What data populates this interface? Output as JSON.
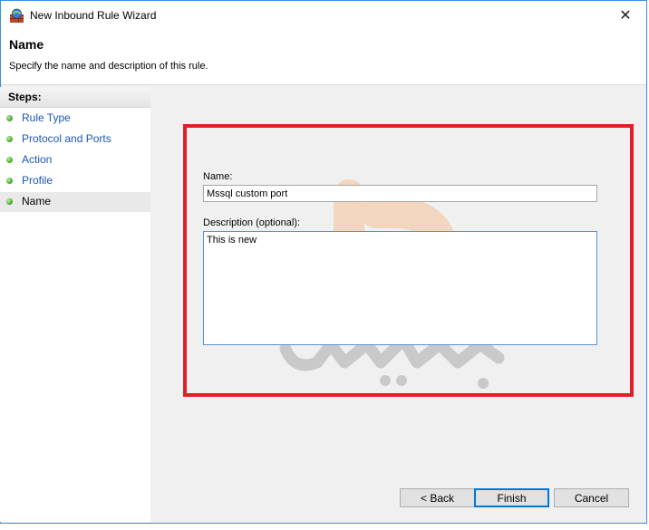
{
  "window": {
    "title": "New Inbound Rule Wizard",
    "close_glyph": "✕"
  },
  "header": {
    "title": "Name",
    "subtitle": "Specify the name and description of this rule."
  },
  "steps": {
    "heading": "Steps:",
    "items": [
      {
        "label": "Rule Type"
      },
      {
        "label": "Protocol and Ports"
      },
      {
        "label": "Action"
      },
      {
        "label": "Profile"
      },
      {
        "label": "Name"
      }
    ],
    "active_index": 4
  },
  "form": {
    "name_label": "Name:",
    "name_value": "Mssql custom port",
    "description_label": "Description (optional):",
    "description_value": "This is new"
  },
  "buttons": {
    "back": "< Back",
    "finish": "Finish",
    "cancel": "Cancel"
  },
  "colors": {
    "highlight_border": "#e41e26",
    "step_bullet": "#3aa01e",
    "step_link": "#1a56b8",
    "watermark_orange": "#f7a25a",
    "watermark_gray": "#7a7a7a"
  },
  "icons": {
    "app": "firewall-icon",
    "close": "close-icon",
    "bullet": "green-dot-icon"
  }
}
